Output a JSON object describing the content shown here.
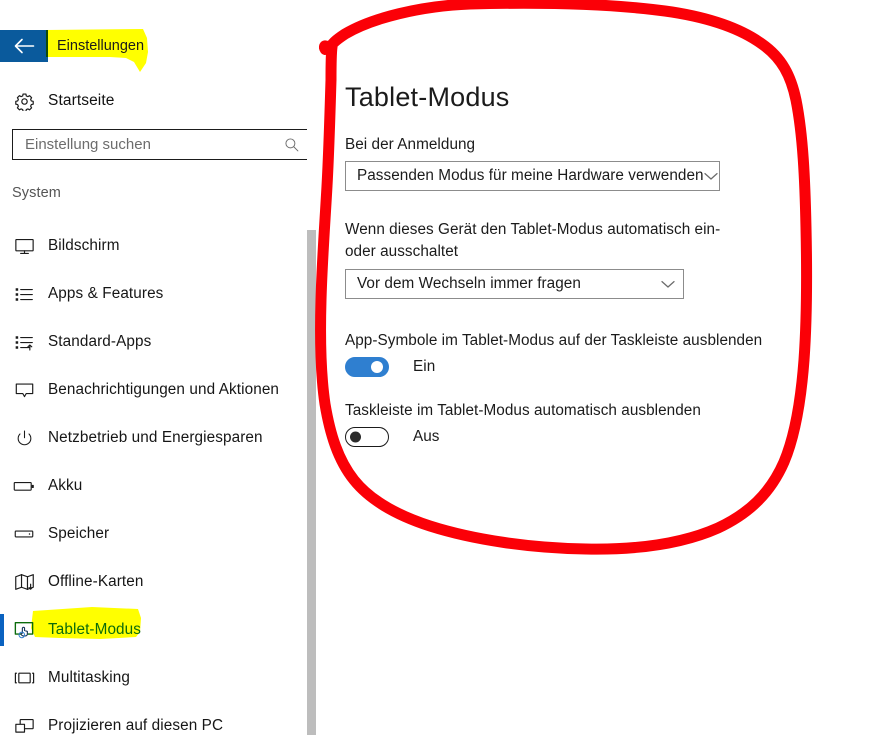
{
  "window": {
    "back_button_icon": "back-arrow-icon",
    "accent_blue": "#0a5a9c",
    "selection_blue": "#0a62c0",
    "toggle_on_blue": "#2f7fd0",
    "highlight_yellow": "#ffff00",
    "annotation_red": "#fb0007"
  },
  "sidebar": {
    "title": "Einstellungen",
    "home": {
      "label": "Startseite",
      "icon": "gear-icon"
    },
    "search": {
      "placeholder": "Einstellung suchen",
      "value": "",
      "icon": "search-icon"
    },
    "section": "System",
    "items": [
      {
        "label": "Bildschirm",
        "icon": "monitor-icon",
        "selected": false
      },
      {
        "label": "Apps & Features",
        "icon": "list-icon",
        "selected": false
      },
      {
        "label": "Standard-Apps",
        "icon": "default-apps-icon",
        "selected": false
      },
      {
        "label": "Benachrichtigungen und Aktionen",
        "icon": "notification-icon",
        "selected": false
      },
      {
        "label": "Netzbetrieb und Energiesparen",
        "icon": "power-icon",
        "selected": false
      },
      {
        "label": "Akku",
        "icon": "battery-icon",
        "selected": false
      },
      {
        "label": "Speicher",
        "icon": "storage-icon",
        "selected": false
      },
      {
        "label": "Offline-Karten",
        "icon": "map-icon",
        "selected": false
      },
      {
        "label": "Tablet-Modus",
        "icon": "tablet-touch-icon",
        "selected": true
      },
      {
        "label": "Multitasking",
        "icon": "multitasking-icon",
        "selected": false
      },
      {
        "label": "Projizieren auf diesen PC",
        "icon": "project-screen-icon",
        "selected": false
      }
    ]
  },
  "main": {
    "title": "Tablet-Modus",
    "signin": {
      "label": "Bei der Anmeldung",
      "value": "Passenden Modus für meine Hardware verwenden",
      "arrow_icon": "chevron-down-icon"
    },
    "autoswitch": {
      "label": "Wenn dieses Gerät den Tablet-Modus automatisch ein- oder ausschaltet",
      "value": "Vor dem Wechseln immer fragen",
      "arrow_icon": "chevron-down-icon"
    },
    "hide_app_icons": {
      "label": "App-Symbole im Tablet-Modus auf der Taskleiste ausblenden",
      "state": "Ein",
      "on": true
    },
    "auto_hide_taskbar": {
      "label": "Taskleiste im Tablet-Modus automatisch ausblenden",
      "state": "Aus",
      "on": false
    }
  },
  "annotations": {
    "highlight_title": "Einstellungen",
    "highlight_nav_item": "Tablet-Modus",
    "circle_note": "red-freehand-circle-around-main-pane"
  }
}
